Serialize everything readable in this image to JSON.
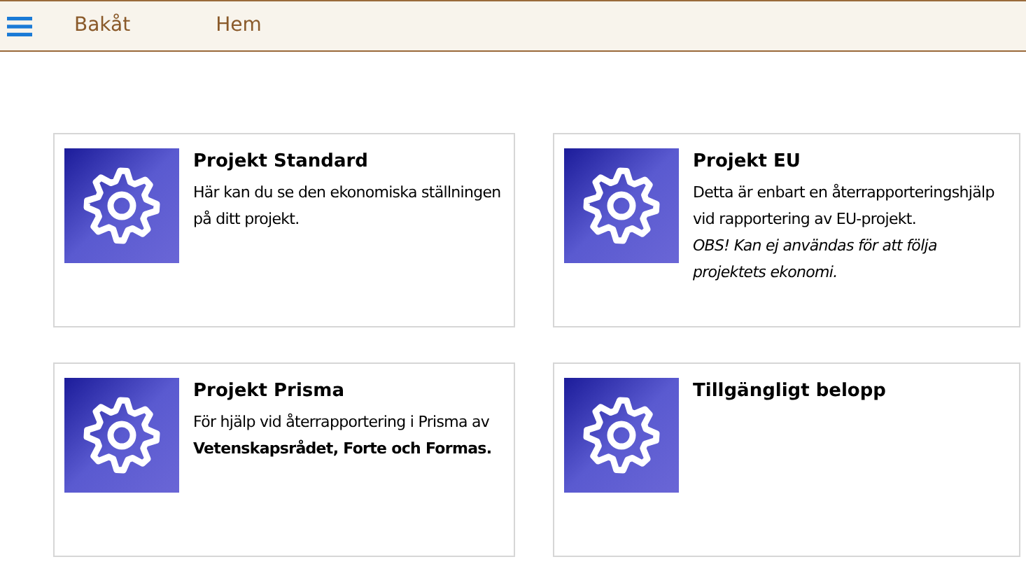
{
  "nav": {
    "back": "Bakåt",
    "home": "Hem"
  },
  "cards": [
    {
      "title": "Projekt Standard",
      "paragraphs": [
        {
          "kind": "plain",
          "text": "Här kan du se den ekonomiska ställningen på ditt projekt."
        }
      ]
    },
    {
      "title": "Projekt EU",
      "paragraphs": [
        {
          "kind": "plain",
          "text": "Detta är enbart en återrapporteringshjälp vid rapportering av EU-projekt."
        },
        {
          "kind": "italic",
          "text": "OBS! Kan ej användas för att följa projektets ekonomi."
        }
      ]
    },
    {
      "title": "Projekt Prisma",
      "paragraphs": [
        {
          "kind": "rich",
          "text": "För hjälp vid återrapportering i Prisma av **Vetenskapsrådet, Forte och Formas.**"
        }
      ]
    },
    {
      "title": "Tillgängligt belopp"
    }
  ]
}
